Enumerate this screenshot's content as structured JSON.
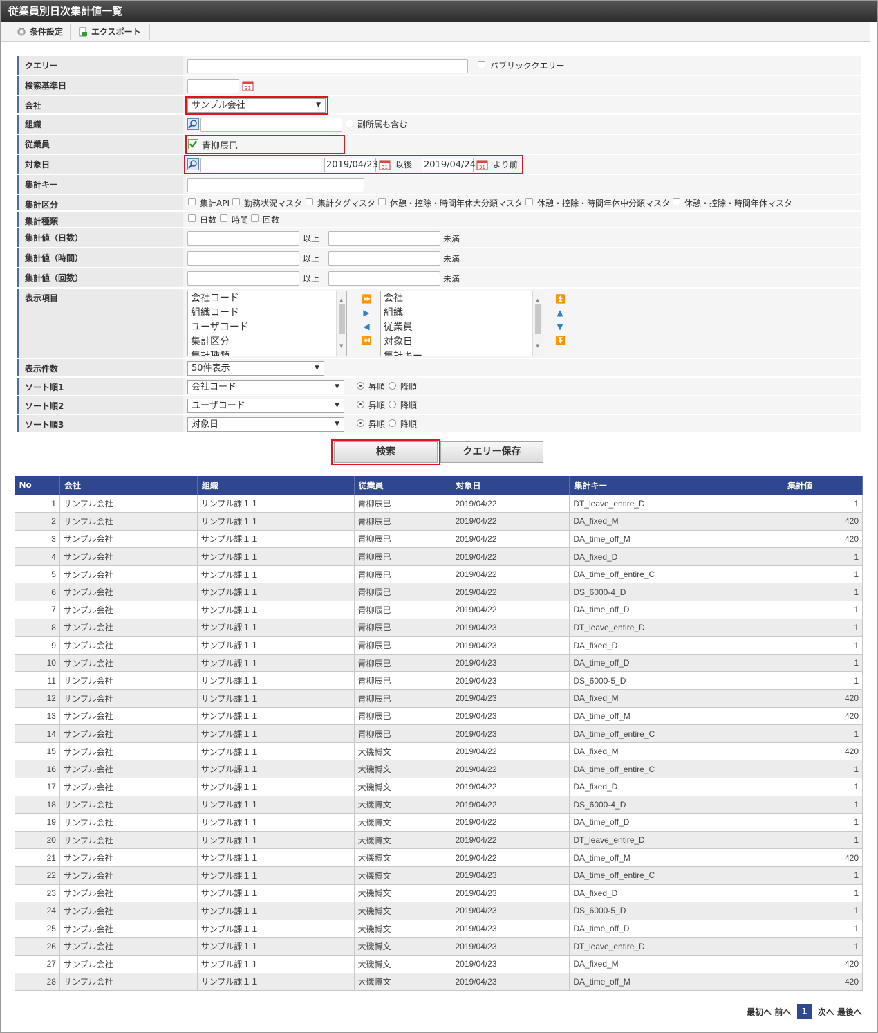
{
  "title": "従業員別日次集計値一覧",
  "toolbar": {
    "condition": "条件設定",
    "export": "エクスポート"
  },
  "form": {
    "query_label": "クエリー",
    "public_query": "パブリッククエリー",
    "base_date_label": "検索基準日",
    "company_label": "会社",
    "company_value": "サンプル会社",
    "org_label": "組織",
    "include_sub": "副所属も含む",
    "employee_label": "従業員",
    "employee_value": "青柳辰巳",
    "target_label": "対象日",
    "date_from": "2019/04/23",
    "after_text": "以後",
    "date_to": "2019/04/24",
    "before_text": "より前",
    "key_label": "集計キー",
    "category_label": "集計区分",
    "categories": [
      "集計API",
      "勤務状況マスタ",
      "集計タグマスタ",
      "休憩・控除・時間年休大分類マスタ",
      "休憩・控除・時間年休中分類マスタ",
      "休憩・控除・時間年休マスタ"
    ],
    "kind_label": "集計種類",
    "kinds": [
      "日数",
      "時間",
      "回数"
    ],
    "val_days_label": "集計値（日数）",
    "val_hours_label": "集計値（時間）",
    "val_count_label": "集計値（回数）",
    "gte": "以上",
    "lt": "未満",
    "display_label": "表示項目",
    "available": [
      "会社コード",
      "組織コード",
      "ユーザコード",
      "集計区分",
      "集計種類"
    ],
    "selected": [
      "会社",
      "組織",
      "従業員",
      "対象日",
      "集計キー"
    ],
    "count_label": "表示件数",
    "count_value": "50件表示",
    "sort1_label": "ソート順1",
    "sort1_value": "会社コード",
    "sort2_label": "ソート順2",
    "sort2_value": "ユーザコード",
    "sort3_label": "ソート順3",
    "sort3_value": "対象日",
    "asc": "昇順",
    "desc": "降順",
    "search_btn": "検索",
    "save_btn": "クエリー保存"
  },
  "table": {
    "headers": [
      "No",
      "会社",
      "組織",
      "従業員",
      "対象日",
      "集計キー",
      "集計値"
    ],
    "rows": [
      [
        "1",
        "サンプル会社",
        "サンプル課１１",
        "青柳辰巳",
        "2019/04/22",
        "DT_leave_entire_D",
        "1"
      ],
      [
        "2",
        "サンプル会社",
        "サンプル課１１",
        "青柳辰巳",
        "2019/04/22",
        "DA_fixed_M",
        "420"
      ],
      [
        "3",
        "サンプル会社",
        "サンプル課１１",
        "青柳辰巳",
        "2019/04/22",
        "DA_time_off_M",
        "420"
      ],
      [
        "4",
        "サンプル会社",
        "サンプル課１１",
        "青柳辰巳",
        "2019/04/22",
        "DA_fixed_D",
        "1"
      ],
      [
        "5",
        "サンプル会社",
        "サンプル課１１",
        "青柳辰巳",
        "2019/04/22",
        "DA_time_off_entire_C",
        "1"
      ],
      [
        "6",
        "サンプル会社",
        "サンプル課１１",
        "青柳辰巳",
        "2019/04/22",
        "DS_6000-4_D",
        "1"
      ],
      [
        "7",
        "サンプル会社",
        "サンプル課１１",
        "青柳辰巳",
        "2019/04/22",
        "DA_time_off_D",
        "1"
      ],
      [
        "8",
        "サンプル会社",
        "サンプル課１１",
        "青柳辰巳",
        "2019/04/23",
        "DT_leave_entire_D",
        "1"
      ],
      [
        "9",
        "サンプル会社",
        "サンプル課１１",
        "青柳辰巳",
        "2019/04/23",
        "DA_fixed_D",
        "1"
      ],
      [
        "10",
        "サンプル会社",
        "サンプル課１１",
        "青柳辰巳",
        "2019/04/23",
        "DA_time_off_D",
        "1"
      ],
      [
        "11",
        "サンプル会社",
        "サンプル課１１",
        "青柳辰巳",
        "2019/04/23",
        "DS_6000-5_D",
        "1"
      ],
      [
        "12",
        "サンプル会社",
        "サンプル課１１",
        "青柳辰巳",
        "2019/04/23",
        "DA_fixed_M",
        "420"
      ],
      [
        "13",
        "サンプル会社",
        "サンプル課１１",
        "青柳辰巳",
        "2019/04/23",
        "DA_time_off_M",
        "420"
      ],
      [
        "14",
        "サンプル会社",
        "サンプル課１１",
        "青柳辰巳",
        "2019/04/23",
        "DA_time_off_entire_C",
        "1"
      ],
      [
        "15",
        "サンプル会社",
        "サンプル課１１",
        "大磯博文",
        "2019/04/22",
        "DA_fixed_M",
        "420"
      ],
      [
        "16",
        "サンプル会社",
        "サンプル課１１",
        "大磯博文",
        "2019/04/22",
        "DA_time_off_entire_C",
        "1"
      ],
      [
        "17",
        "サンプル会社",
        "サンプル課１１",
        "大磯博文",
        "2019/04/22",
        "DA_fixed_D",
        "1"
      ],
      [
        "18",
        "サンプル会社",
        "サンプル課１１",
        "大磯博文",
        "2019/04/22",
        "DS_6000-4_D",
        "1"
      ],
      [
        "19",
        "サンプル会社",
        "サンプル課１１",
        "大磯博文",
        "2019/04/22",
        "DA_time_off_D",
        "1"
      ],
      [
        "20",
        "サンプル会社",
        "サンプル課１１",
        "大磯博文",
        "2019/04/22",
        "DT_leave_entire_D",
        "1"
      ],
      [
        "21",
        "サンプル会社",
        "サンプル課１１",
        "大磯博文",
        "2019/04/22",
        "DA_time_off_M",
        "420"
      ],
      [
        "22",
        "サンプル会社",
        "サンプル課１１",
        "大磯博文",
        "2019/04/23",
        "DA_time_off_entire_C",
        "1"
      ],
      [
        "23",
        "サンプル会社",
        "サンプル課１１",
        "大磯博文",
        "2019/04/23",
        "DA_fixed_D",
        "1"
      ],
      [
        "24",
        "サンプル会社",
        "サンプル課１１",
        "大磯博文",
        "2019/04/23",
        "DS_6000-5_D",
        "1"
      ],
      [
        "25",
        "サンプル会社",
        "サンプル課１１",
        "大磯博文",
        "2019/04/23",
        "DA_time_off_D",
        "1"
      ],
      [
        "26",
        "サンプル会社",
        "サンプル課１１",
        "大磯博文",
        "2019/04/23",
        "DT_leave_entire_D",
        "1"
      ],
      [
        "27",
        "サンプル会社",
        "サンプル課１１",
        "大磯博文",
        "2019/04/23",
        "DA_fixed_M",
        "420"
      ],
      [
        "28",
        "サンプル会社",
        "サンプル課１１",
        "大磯博文",
        "2019/04/23",
        "DA_time_off_M",
        "420"
      ]
    ]
  },
  "pager": {
    "first": "最初へ",
    "prev": "前へ",
    "current": "1",
    "next": "次へ",
    "last": "最後へ"
  },
  "colors": {
    "header": "#30478f",
    "highlight": "#e0141e",
    "accent": "#4a6da8"
  }
}
